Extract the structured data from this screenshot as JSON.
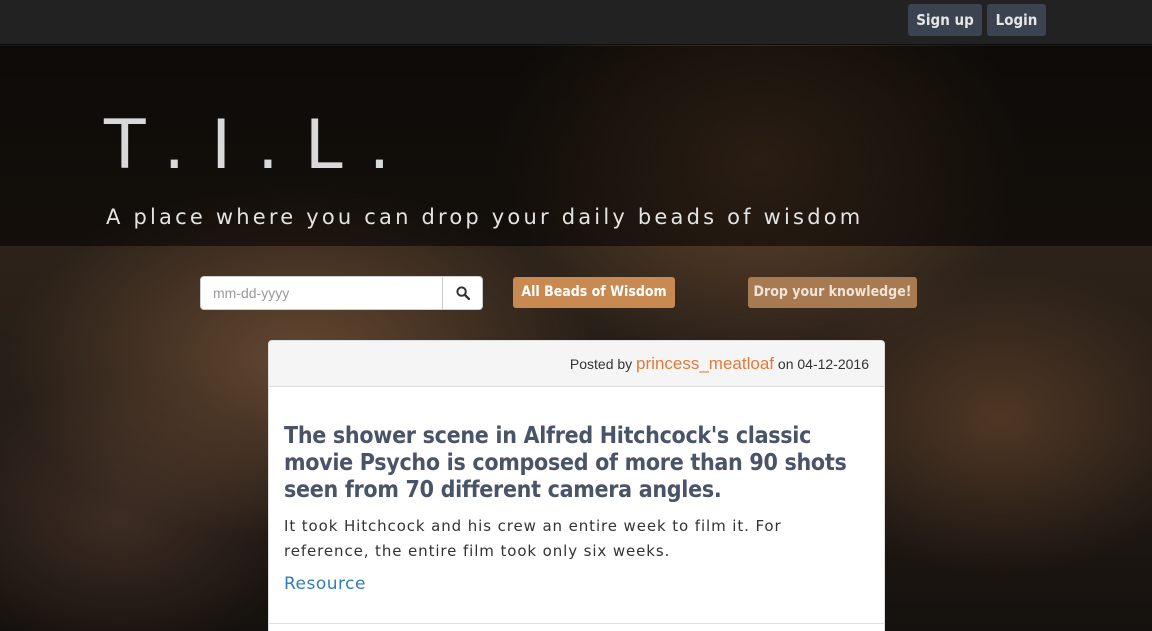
{
  "navbar": {
    "signup_label": "Sign up",
    "login_label": "Login"
  },
  "hero": {
    "title": "T.I.L.",
    "subtitle": "A place where you can drop your daily beads of wisdom"
  },
  "search": {
    "placeholder": "mm-dd-yyyy",
    "button_icon": "search-icon"
  },
  "actions": {
    "all_label": "All Beads of Wisdom",
    "drop_label": "Drop your knowledge!"
  },
  "post": {
    "posted_by_prefix": "Posted by",
    "author": "princess_meatloaf",
    "date_prefix": "on",
    "date": "04-12-2016",
    "title": "The shower scene in Alfred Hitchcock's classic movie Psycho is composed of more than 90 shots seen from 70 different camera angles.",
    "body": "It took Hitchcock and his crew an entire week to film it. For reference, the entire film took only six weeks.",
    "link_label": "Resource"
  },
  "colors": {
    "accent_orange": "#c98a52",
    "author_link": "#e07a3c",
    "resource_link": "#337ab7",
    "navbar_bg": "#222222",
    "nav_button_bg": "#3b4350"
  }
}
